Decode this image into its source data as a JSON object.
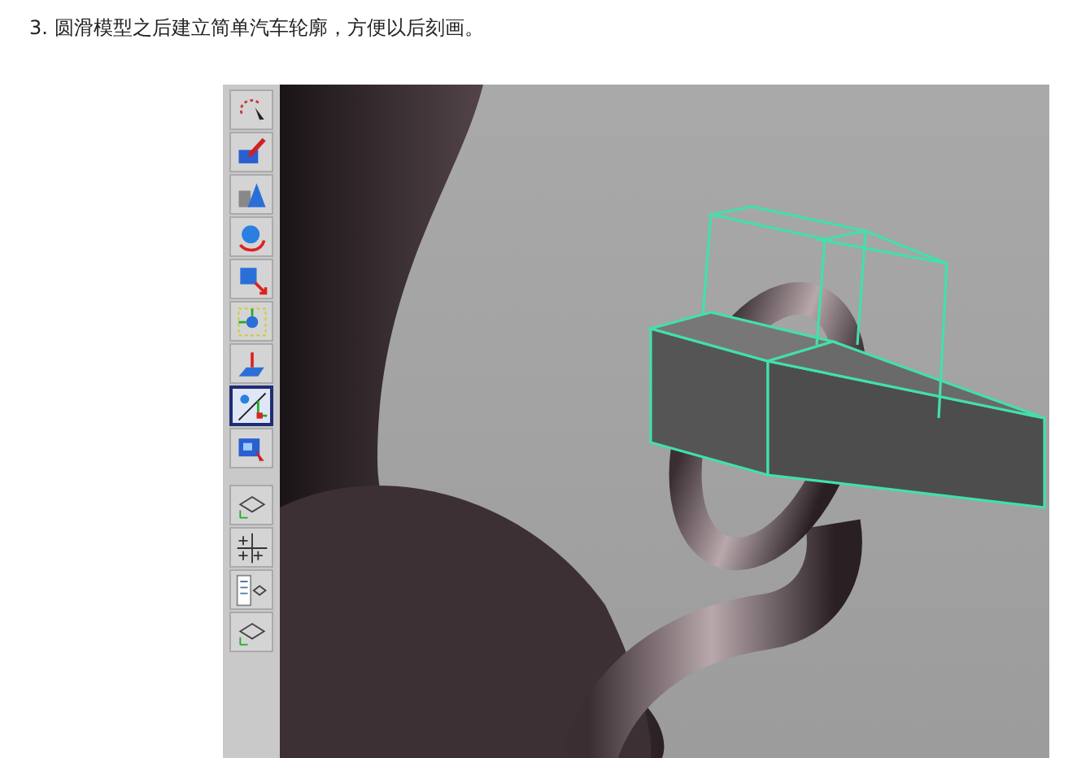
{
  "step": {
    "text": "3. 圆滑模型之后建立简单汽车轮廓，方便以后刻画。"
  },
  "app_screenshot": {
    "tools": [
      {
        "kind": "lasso",
        "selected": false
      },
      {
        "kind": "paint",
        "selected": false
      },
      {
        "kind": "shapes",
        "selected": false
      },
      {
        "kind": "rotate",
        "selected": false
      },
      {
        "kind": "scale",
        "selected": false
      },
      {
        "kind": "manipulator",
        "selected": false
      },
      {
        "kind": "soft",
        "selected": false
      },
      {
        "kind": "show-manipulator",
        "selected": true
      },
      {
        "kind": "select-face",
        "selected": false
      }
    ],
    "layouts": [
      {
        "kind": "single"
      },
      {
        "kind": "four"
      },
      {
        "kind": "outliner"
      },
      {
        "kind": "single"
      }
    ]
  }
}
